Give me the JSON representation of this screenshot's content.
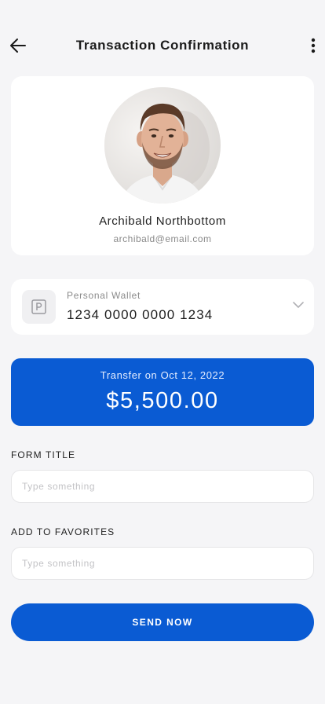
{
  "header": {
    "title": "Transaction Confirmation",
    "back_icon": "arrow-left-icon",
    "more_icon": "more-vertical-icon"
  },
  "recipient": {
    "name": "Archibald Northbottom",
    "email": "archibald@email.com",
    "avatar": "recipient-photo"
  },
  "wallet": {
    "label": "Personal Wallet",
    "number": "1234 0000 0000 1234",
    "icon": "wallet-icon",
    "dropdown_icon": "chevron-down-icon"
  },
  "transfer": {
    "date_label": "Transfer on Oct 12, 2022",
    "amount": "$5,500.00"
  },
  "form": {
    "form_title_label": "FORM TITLE",
    "form_title_placeholder": "Type something",
    "favorites_label": "ADD TO FAVORITES",
    "favorites_placeholder": "Type something"
  },
  "actions": {
    "send_label": "SEND NOW"
  },
  "colors": {
    "accent": "#0a5bd3",
    "background": "#f5f5f7",
    "card": "#ffffff"
  }
}
